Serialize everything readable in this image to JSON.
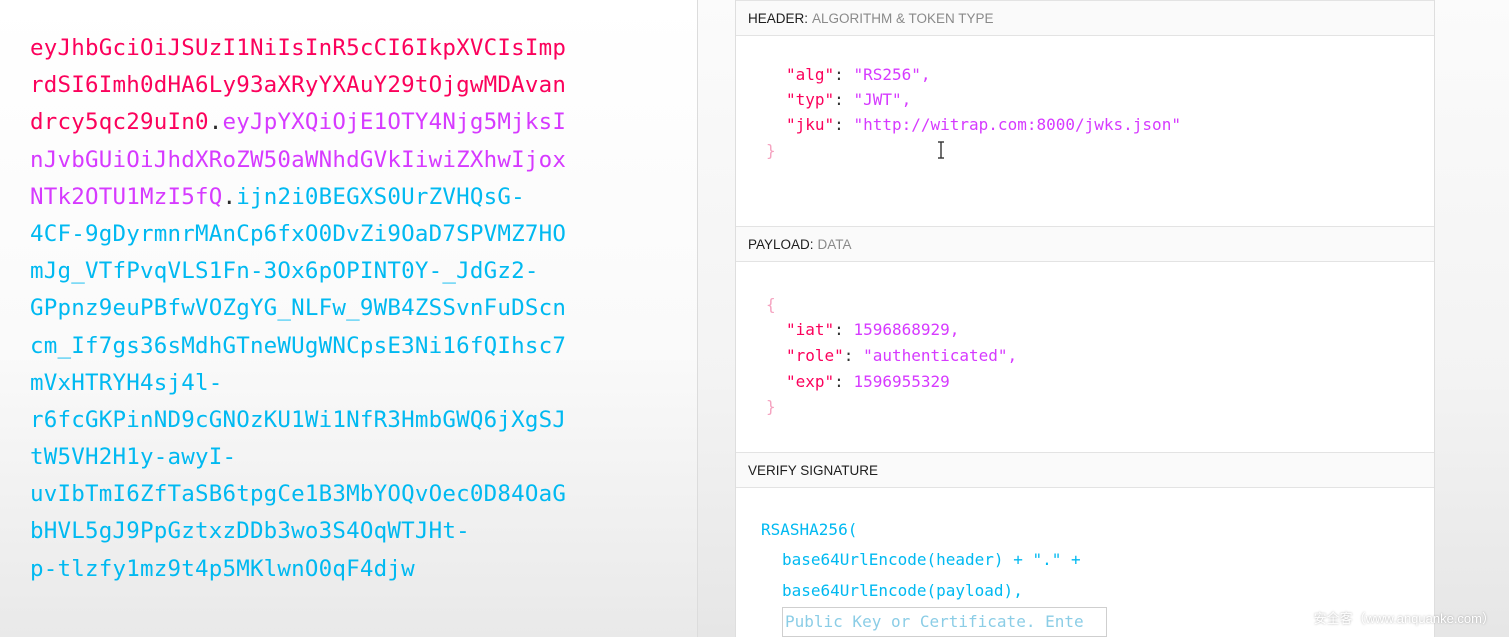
{
  "encoded_token": {
    "lines": [
      [
        {
          "t": "eyJhbGciOiJSUzI1NiIsInR5cCI6IkpXVCIsImp",
          "c": "header"
        }
      ],
      [
        {
          "t": "rdSI6Imh0dHA6Ly93aXRyYXAuY29tOjgwMDAvan",
          "c": "header"
        }
      ],
      [
        {
          "t": "drcy5qc29uIn0",
          "c": "header"
        },
        {
          "t": ".",
          "c": "dot"
        },
        {
          "t": "eyJpYXQiOjE1OTY4Njg5MjksI",
          "c": "payload"
        }
      ],
      [
        {
          "t": "nJvbGUiOiJhdXRoZW50aWNhdGVkIiwiZXhwIjox",
          "c": "payload"
        }
      ],
      [
        {
          "t": "NTk2OTU1MzI5fQ",
          "c": "payload"
        },
        {
          "t": ".",
          "c": "dot"
        },
        {
          "t": "ijn2i0BEGXS0UrZVHQsG-",
          "c": "signature"
        }
      ],
      [
        {
          "t": "4CF-9gDyrmnrMAnCp6fxO0DvZi9OaD7SPVMZ7HO",
          "c": "signature"
        }
      ],
      [
        {
          "t": "mJg_VTfPvqVLS1Fn-3Ox6pOPINT0Y-_JdGz2-",
          "c": "signature"
        }
      ],
      [
        {
          "t": "GPpnz9euPBfwVOZgYG_NLFw_9WB4ZSSvnFuDScn",
          "c": "signature"
        }
      ],
      [
        {
          "t": "cm_If7gs36sMdhGTneWUgWNCpsE3Ni16fQIhsc7",
          "c": "signature"
        }
      ],
      [
        {
          "t": "mVxHTRYH4sj4l-",
          "c": "signature"
        }
      ],
      [
        {
          "t": "r6fcGKPinND9cGNOzKU1Wi1NfR3HmbGWQ6jXgSJ",
          "c": "signature"
        }
      ],
      [
        {
          "t": "tW5VH2H1y-awyI-",
          "c": "signature"
        }
      ],
      [
        {
          "t": "uvIbTmI6ZfTaSB6tpgCe1B3MbYOQvOec0D84OaG",
          "c": "signature"
        }
      ],
      [
        {
          "t": "bHVL5gJ9PpGztxzDDb3wo3S4OqWTJHt-",
          "c": "signature"
        }
      ],
      [
        {
          "t": "p-tlzfy1mz9t4p5MKlwnO0qF4djw",
          "c": "signature"
        }
      ]
    ]
  },
  "header_section": {
    "title": "HEADER:",
    "subtitle": "ALGORITHM & TOKEN TYPE",
    "alg_key": "\"alg\"",
    "alg_val": "\"RS256\",",
    "typ_key": "\"typ\"",
    "typ_val": "\"JWT\",",
    "jku_key": "\"jku\"",
    "jku_val": "\"http://witrap.com:8000/jwks.json\"",
    "close_brace": "}"
  },
  "payload_section": {
    "title": "PAYLOAD:",
    "subtitle": "DATA",
    "open_brace": "{",
    "iat_key": "\"iat\"",
    "iat_val": "1596868929,",
    "role_key": "\"role\"",
    "role_val": "\"authenticated\",",
    "exp_key": "\"exp\"",
    "exp_val": "1596955329",
    "close_brace": "}"
  },
  "signature_section": {
    "title": "VERIFY SIGNATURE",
    "line1": "RSASHA256(",
    "line2": "base64UrlEncode(header) + \".\" +",
    "line3": "base64UrlEncode(payload),",
    "key_placeholder": "Public Key or Certificate. Ente"
  },
  "watermark": "安全客（www.anquanke.com）",
  "colors": {
    "header": "#fb015b",
    "payload": "#d63aff",
    "signature": "#00b9f1"
  },
  "icons": {
    "text_cursor": "i-beam-cursor-icon"
  }
}
